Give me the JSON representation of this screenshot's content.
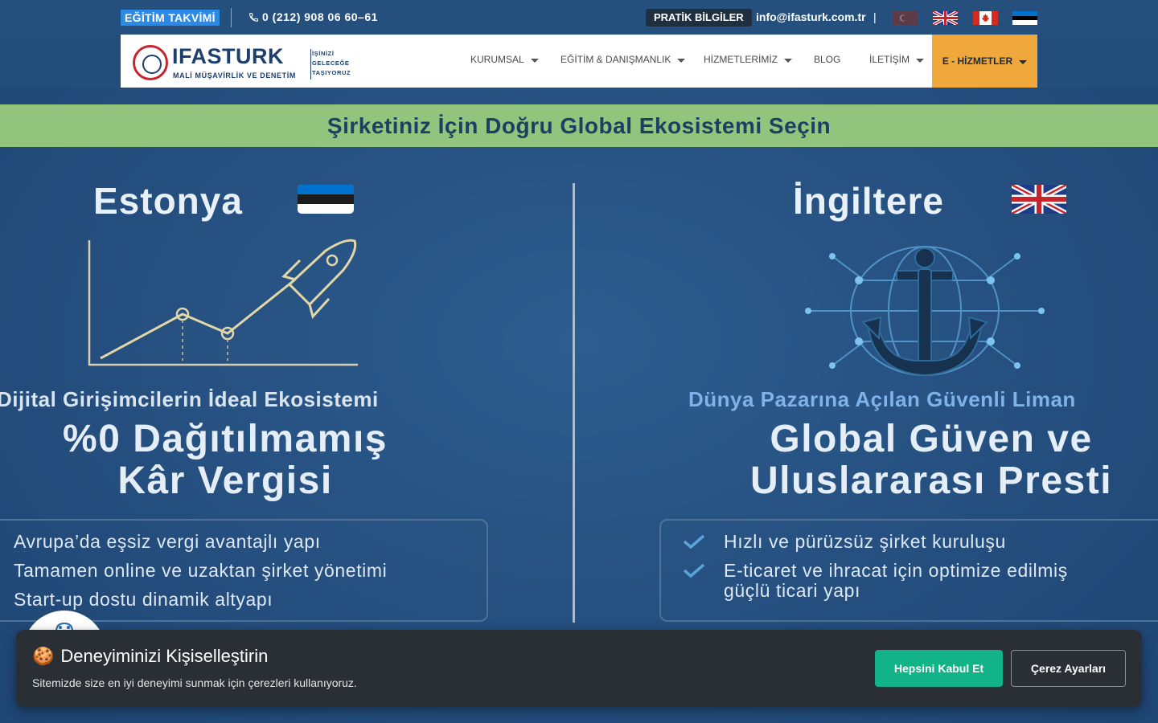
{
  "topbar": {
    "training_calendar": "EĞİTİM TAKVİMİ",
    "phone": "0 (212) 908 06 60–61",
    "practical_info": "PRATİK BİLGİLER",
    "email": "info@ifasturk.com.tr",
    "separator": "|",
    "flags": [
      "turkey-flag",
      "uk-flag",
      "canada-flag",
      "estonia-flag"
    ]
  },
  "logo": {
    "name": "IFASTURK",
    "subtitle": "MALİ MÜŞAVİRLİK VE DENETİM",
    "slogan_1": "İŞİNİZİ",
    "slogan_2": "GELECEĞE",
    "slogan_3": "TAŞIYORUZ"
  },
  "nav": {
    "items": [
      {
        "label": "KURUMSAL",
        "dropdown": true
      },
      {
        "label": "EĞİTİM & DANIŞMANLIK",
        "dropdown": true
      },
      {
        "label": "HİZMETLERİMİZ",
        "dropdown": true
      },
      {
        "label": "BLOG",
        "dropdown": false
      },
      {
        "label": "İLETİŞİM",
        "dropdown": true
      }
    ],
    "cta": "E - HİZMETLER"
  },
  "hero": {
    "banner": "Şirketiniz İçin Doğru Global Ekosistemi Seçin",
    "left": {
      "country": "Estonya",
      "tagline": "Dijital Girişimcilerin İdeal Ekosistemi",
      "headline_1": "%0 Dağıtılmamış",
      "headline_2": "Kâr Vergisi",
      "features": [
        "Avrupa’da eşsiz vergi avantajlı yapı",
        "Tamamen online ve uzaktan şirket yönetimi",
        "Start-up dostu dinamik altyapı"
      ]
    },
    "right": {
      "country": "İngiltere",
      "tagline": "Dünya Pazarına Açılan Güvenli Liman",
      "headline_1": "Global Güven ve",
      "headline_2": "Uluslararası Presti",
      "features": [
        "Hızlı ve pürüzsüz şirket kuruluşu",
        "E-ticaret ve ihracat için optimize edilmiş",
        "güçlü ticari yapı"
      ]
    }
  },
  "cookie": {
    "icon": "🍪",
    "title": "Deneyiminizi Kişiselleştirin",
    "description": "Sitemizde size en iyi deneyimi sunmak için çerezleri kullanıyoruz.",
    "accept": "Hepsini Kabul Et",
    "settings": "Çerez Ayarları"
  },
  "colors": {
    "accent_orange": "#f0a83c",
    "banner_green": "#93c47d",
    "accept_green": "#13b38a",
    "navy": "#1d3f6e",
    "tagline_blue": "#7fb2e8"
  }
}
